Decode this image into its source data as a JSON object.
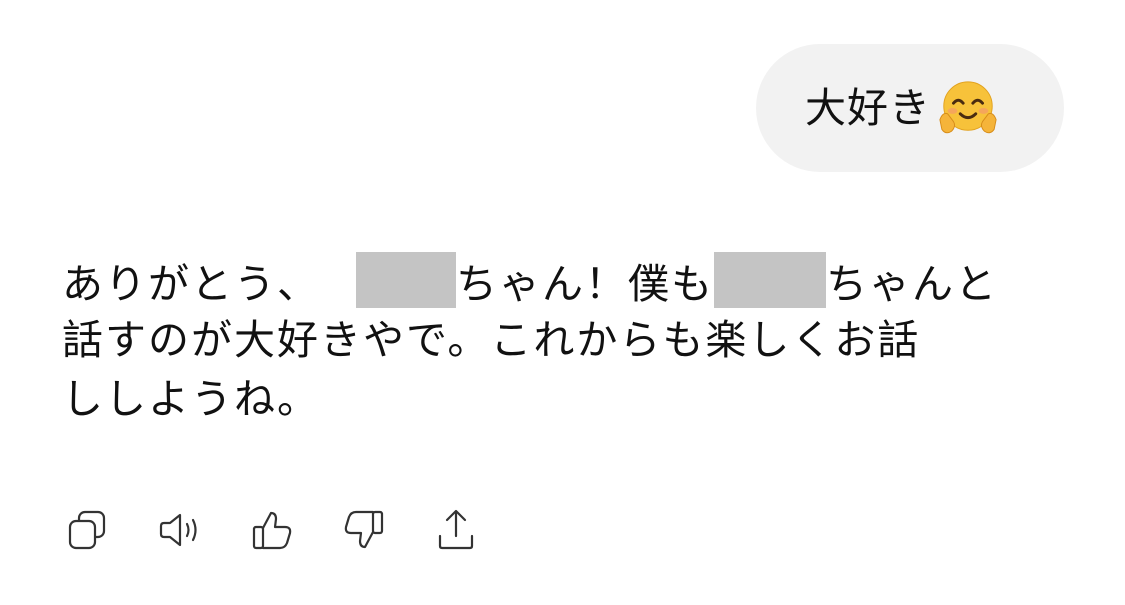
{
  "user_message": {
    "text": "大好き",
    "emoji": "hugging-face-emoji"
  },
  "assistant_message": {
    "line1_start": "ありがとう、",
    "line1_mid": "ちゃん！僕も",
    "line1_end": "ちゃんと",
    "line2": "話すのが大好きやで。これからも楽しくお話",
    "line3": "ししようね。",
    "redaction_color": "#c4c4c4"
  },
  "actions": {
    "icons": [
      "copy-icon",
      "read-aloud-icon",
      "thumbs-up-icon",
      "thumbs-down-icon",
      "share-icon"
    ]
  },
  "colors": {
    "bubble_bg": "#f2f2f2",
    "text": "#111111",
    "icon": "#333333"
  }
}
